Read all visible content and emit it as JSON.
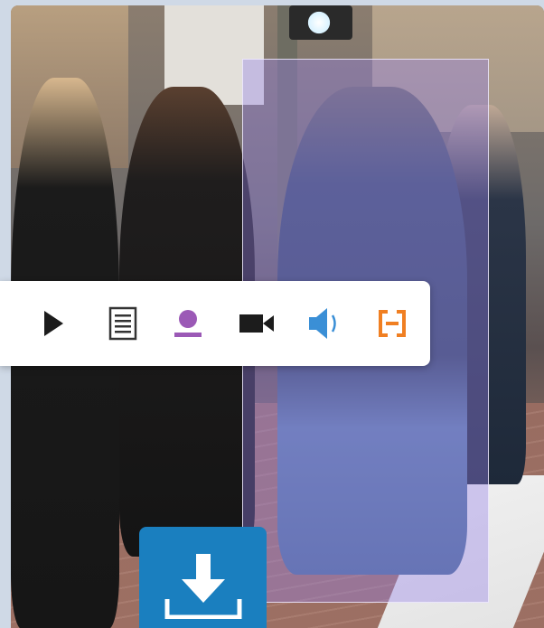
{
  "scene": {
    "image": "street-crosswalk-photo",
    "highlight_color": "#9682eb"
  },
  "toolbar": {
    "items": [
      {
        "icon": "play-icon",
        "color": "#1c1c1c"
      },
      {
        "icon": "document-icon",
        "color": "#333333"
      },
      {
        "icon": "person-icon",
        "color": "#9b59b6"
      },
      {
        "icon": "video-camera-icon",
        "color": "#1c1c1c"
      },
      {
        "icon": "speaker-icon",
        "color": "#3a8fd6"
      },
      {
        "icon": "frame-brackets-icon",
        "color": "#f07f22"
      }
    ]
  },
  "download": {
    "icon": "download-icon",
    "color": "#1a7fbf"
  }
}
